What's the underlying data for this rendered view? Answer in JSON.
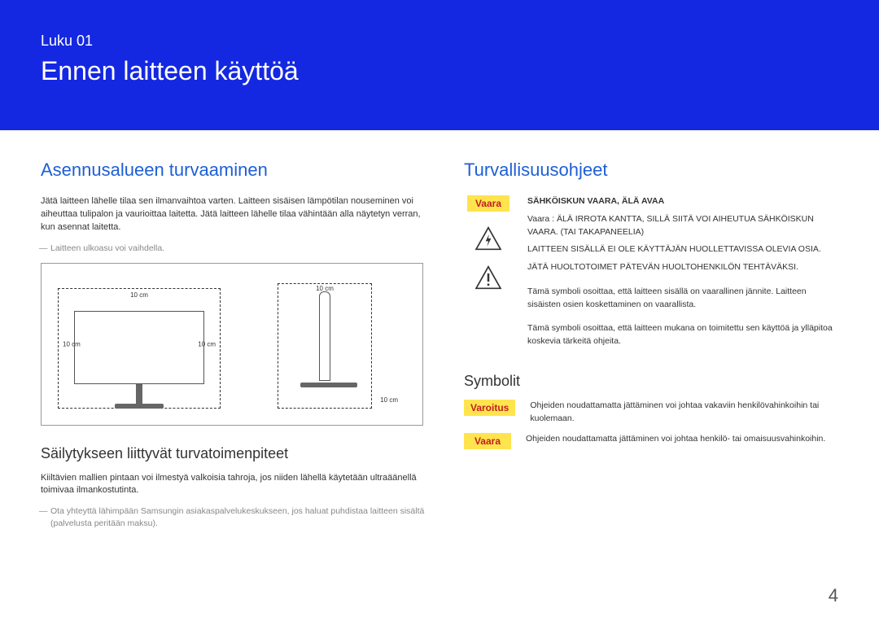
{
  "header": {
    "chapter_label": "Luku 01",
    "chapter_title": "Ennen laitteen käyttöä"
  },
  "left": {
    "section_title": "Asennusalueen turvaaminen",
    "intro": "Jätä laitteen lähelle tilaa sen ilmanvaihtoa varten. Laitteen sisäisen lämpötilan nouseminen voi aiheuttaa tulipalon ja vaurioittaa laitetta. Jätä laitteen lähelle tilaa vähintään alla näytetyn verran, kun asennat laitetta.",
    "note1": "Laitteen ulkoasu voi vaihdella.",
    "diagram": {
      "dim_top_front": "10 cm",
      "dim_left_front": "10 cm",
      "dim_right_front": "10 cm",
      "dim_top_side": "10 cm",
      "dim_bot_side": "10 cm"
    },
    "subsection_title": "Säilytykseen liittyvät turvatoimenpiteet",
    "storage_body": "Kiiltävien mallien pintaan voi ilmestyä valkoisia tahroja, jos niiden lähellä käytetään ultraäänellä toimivaa ilmankostutinta.",
    "note2": "Ota yhteyttä lähimpään Samsungin asiakaspalvelukeskukseen, jos haluat puhdistaa laitteen sisältä (palvelusta peritään maksu)."
  },
  "right": {
    "section_title": "Turvallisuusohjeet",
    "vaara_badge": "Vaara",
    "safety_heading": "SÄHKÖISKUN VAARA, ÄLÄ AVAA",
    "safety_p1": "Vaara : ÄLÄ IRROTA KANTTA, SILLÄ SIITÄ VOI AIHEUTUA SÄHKÖISKUN VAARA. (TAI TAKAPANEELIA)",
    "safety_p2": "LAITTEEN SISÄLLÄ EI OLE KÄYTTÄJÄN HUOLLETTAVISSA OLEVIA OSIA.",
    "safety_p3": "JÄTÄ HUOLTOTOIMET PÄTEVÄN HUOLTOHENKILÖN TEHTÄVÄKSI.",
    "bolt_text": "Tämä symboli osoittaa, että laitteen sisällä on vaarallinen jännite. Laitteen sisäisten osien koskettaminen on vaarallista.",
    "excl_text": "Tämä symboli osoittaa, että laitteen mukana on toimitettu sen käyttöä ja ylläpitoa koskevia tärkeitä ohjeita.",
    "symbols_heading": "Symbolit",
    "varoitus_badge": "Varoitus",
    "varoitus_text": "Ohjeiden noudattamatta jättäminen voi johtaa vakaviin henkilövahinkoihin tai kuolemaan.",
    "vaara2_badge": "Vaara",
    "vaara2_text": "Ohjeiden noudattamatta jättäminen voi johtaa henkilö- tai omaisuusvahinkoihin."
  },
  "page_number": "4"
}
